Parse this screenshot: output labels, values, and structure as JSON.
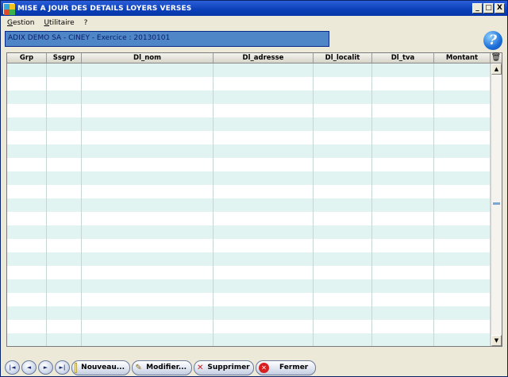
{
  "window": {
    "title": "MISE A JOUR DES DETAILS LOYERS VERSES",
    "minimize_glyph": "_",
    "maximize_glyph": "□",
    "close_glyph": "X"
  },
  "menu": {
    "items": [
      {
        "accel": "G",
        "rest": "estion"
      },
      {
        "accel": "U",
        "rest": "tilitaire"
      },
      {
        "accel": "",
        "rest": "?"
      }
    ]
  },
  "company": {
    "text": "ADIX DEMO SA  - CINEY - Exercice : 20130101"
  },
  "help": {
    "glyph": "?"
  },
  "grid": {
    "columns": [
      "Grp",
      "Ssgrp",
      "Dl_nom",
      "Dl_adresse",
      "Dl_localit",
      "Dl_tva",
      "Montant"
    ],
    "trash_glyph": "🗑",
    "scroll_up_glyph": "▲",
    "scroll_down_glyph": "▼"
  },
  "toolbar": {
    "nav": {
      "first": "|◄",
      "prev": "◄",
      "next": "►",
      "last": "►|"
    },
    "buttons": {
      "nouveau": "Nouveau...",
      "modifier": "Modifier...",
      "supprimer": "Supprimer",
      "fermer": "Fermer"
    }
  },
  "colors": {
    "title_bar": "#0a3fb8",
    "company_bar": "#4f86c8",
    "row_alt": "#e2f4f1",
    "accent_red": "#d82020"
  }
}
